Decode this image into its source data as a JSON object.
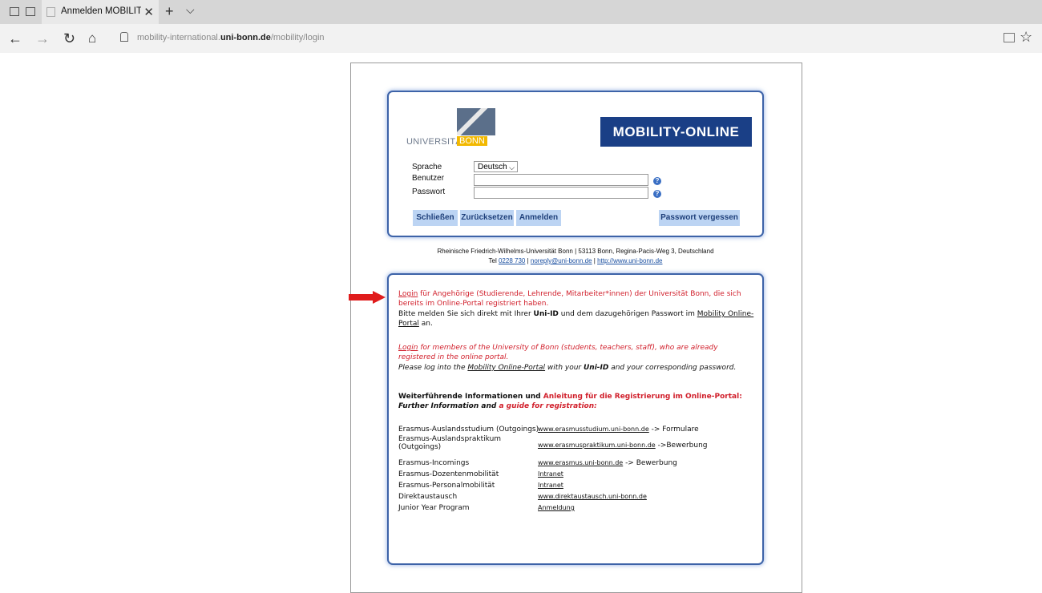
{
  "browser": {
    "tab_title": "Anmelden MOBILITY-O",
    "url_prefix": "mobility-international.",
    "url_domain": "uni-bonn.de",
    "url_path": "/mobility/login"
  },
  "logos": {
    "uni_text": "UNIVERSITÄT",
    "uni_bonn": "BONN",
    "mobility": "MOBILITY-ONLINE"
  },
  "form": {
    "sprache_label": "Sprache",
    "sprache_value": "Deutsch",
    "benutzer_label": "Benutzer",
    "passwort_label": "Passwort",
    "help_glyph": "?",
    "buttons": {
      "close": "Schließen",
      "reset": "Zurücksetzen",
      "login": "Anmelden",
      "forgot": "Passwort vergessen"
    }
  },
  "footer": {
    "line1": "Rheinische Friedrich-Wilhelms-Universität Bonn | 53113 Bonn, Regina-Pacis-Weg 3, Deutschland",
    "tel_label": "Tel",
    "tel": "0228 730",
    "sep": "|",
    "email": "noreply@uni-bonn.de",
    "web": "http://www.uni-bonn.de"
  },
  "info": {
    "de_login": "Login",
    "de_red_rest": " für Angehörige (Studierende, Lehrende, Mitarbeiter*innen) der Universität Bonn, die sich bereits im Online-Portal registriert haben.",
    "de_line_a": "Bitte melden Sie sich direkt mit Ihrer ",
    "de_uni_id": "Uni-ID",
    "de_line_b": " und dem dazugehörigen Passwort im ",
    "de_portal": "Mobility Online-Portal",
    "de_line_c": " an.",
    "en_login": "Login",
    "en_red_rest": " for members of the University of Bonn (students, teachers, staff), who are already registered in the online portal.",
    "en_line_a": "Please log into the ",
    "en_portal": "Mobility Online-Portal",
    "en_line_b": " with your ",
    "en_uni_id": "Uni-ID",
    "en_line_c": " and your corresponding password.",
    "more_de_black": "Weiterführende Informationen und ",
    "more_de_red": "Anleitung für die Registrierung im Online-Portal:",
    "more_en_black": "Further Information and ",
    "more_en_red": "a guide for registration:",
    "links": [
      {
        "label": "Erasmus-Auslandsstudium (Outgoings)",
        "link": "www.erasmusstudium.uni-bonn.de",
        "suffix": " -> Formulare"
      },
      {
        "label": "Erasmus-Auslandspraktikum (Outgoings)",
        "link": "www.erasmuspraktikum.uni-bonn.de",
        "suffix": " ->Bewerbung"
      },
      {
        "label": "Erasmus-Incomings",
        "link": "www.erasmus.uni-bonn.de",
        "suffix": " -> Bewerbung"
      },
      {
        "label": "Erasmus-Dozentenmobilität",
        "link": "Intranet",
        "suffix": ""
      },
      {
        "label": "Erasmus-Personalmobilität",
        "link": "Intranet",
        "suffix": ""
      },
      {
        "label": "Direktaustausch",
        "link": "www.direktaustausch.uni-bonn.de",
        "suffix": ""
      },
      {
        "label": "Junior Year Program",
        "link": "Anmeldung",
        "suffix": ""
      }
    ]
  }
}
